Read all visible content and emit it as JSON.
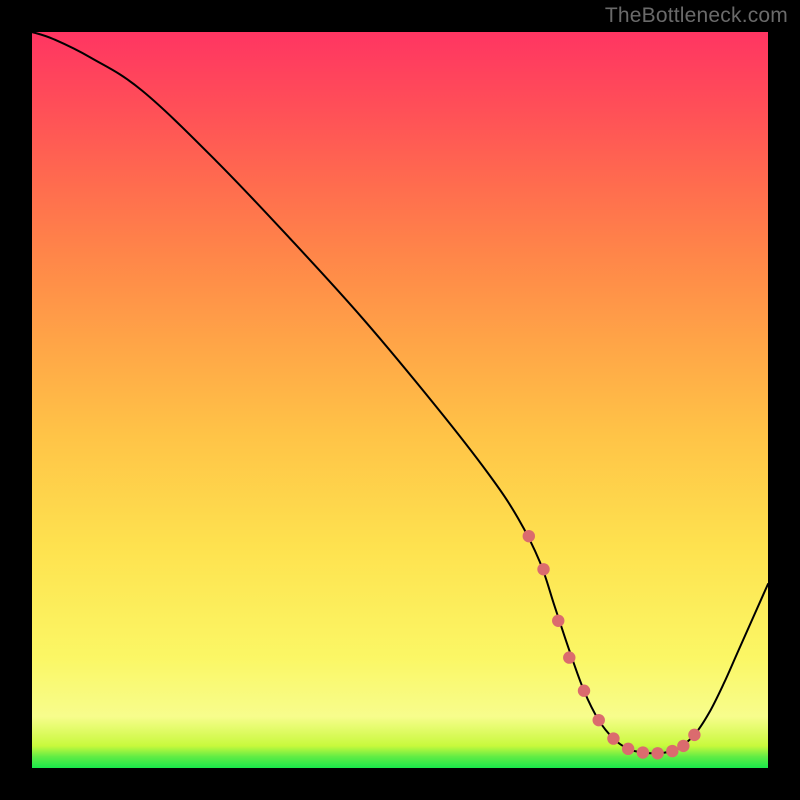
{
  "attribution": "TheBottleneck.com",
  "chart_data": {
    "type": "line",
    "title": "",
    "xlabel": "",
    "ylabel": "",
    "xlim": [
      0,
      100
    ],
    "ylim": [
      0,
      100
    ],
    "series": [
      {
        "name": "bottleneck-curve",
        "x": [
          0,
          3,
          8,
          15,
          25,
          35,
          45,
          55,
          62,
          66,
          69,
          71,
          73,
          75,
          77,
          79,
          81,
          83,
          85,
          86.5,
          88,
          90,
          92,
          94,
          96,
          100
        ],
        "y": [
          100,
          99,
          96.5,
          92,
          82.5,
          72,
          61,
          49,
          40,
          34,
          28,
          22,
          16,
          10.5,
          6.5,
          4,
          2.6,
          2.1,
          2,
          2.2,
          2.8,
          4.5,
          7.5,
          11.5,
          16,
          25
        ]
      }
    ],
    "markers": {
      "name": "highlighted-points",
      "x": [
        67.5,
        69.5,
        71.5,
        73,
        75,
        77,
        79,
        81,
        83,
        85,
        87,
        88.5,
        90
      ],
      "y": [
        31.5,
        27,
        20,
        15,
        10.5,
        6.5,
        4,
        2.6,
        2.1,
        2,
        2.3,
        3.0,
        4.5
      ]
    },
    "colors": {
      "curve": "#000000",
      "marker": "#db6b6e",
      "gradient_top": "#ff3562",
      "gradient_bottom": "#19e84a"
    }
  }
}
